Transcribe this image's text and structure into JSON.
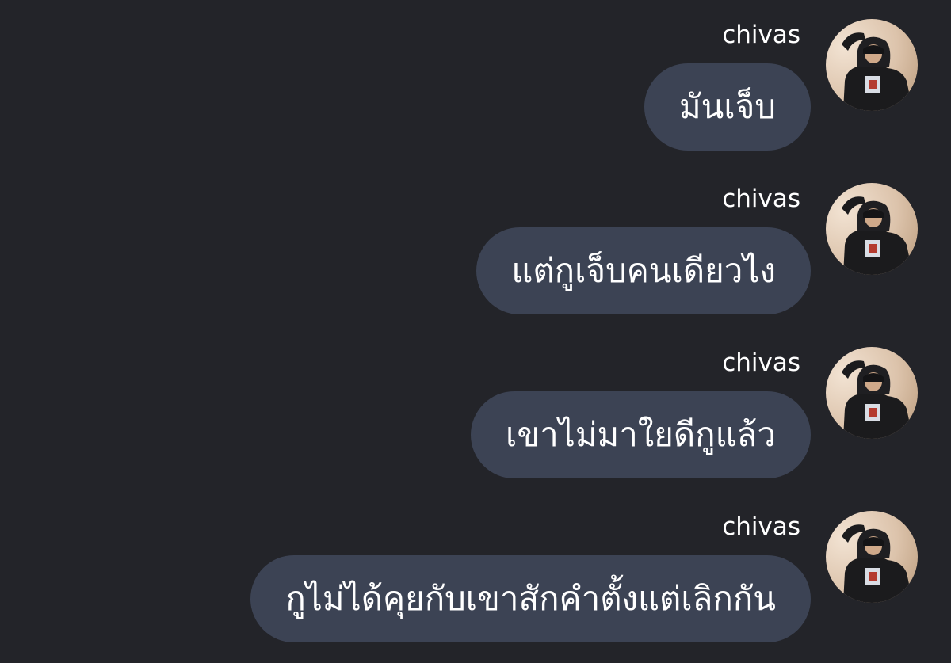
{
  "messages": [
    {
      "sender": "chivas",
      "text": "มันเจ็บ"
    },
    {
      "sender": "chivas",
      "text": "แต่กูเจ็บคนเดียวไง"
    },
    {
      "sender": "chivas",
      "text": "เขาไม่มาใยดีกูแล้ว"
    },
    {
      "sender": "chivas",
      "text": "กูไม่ได้คุยกับเขาสักคำตั้งแต่เลิกกัน"
    }
  ],
  "colors": {
    "background": "#232429",
    "bubble": "#3c4354",
    "text": "#ffffff"
  },
  "icons": {
    "avatar": "user-avatar-photo"
  }
}
